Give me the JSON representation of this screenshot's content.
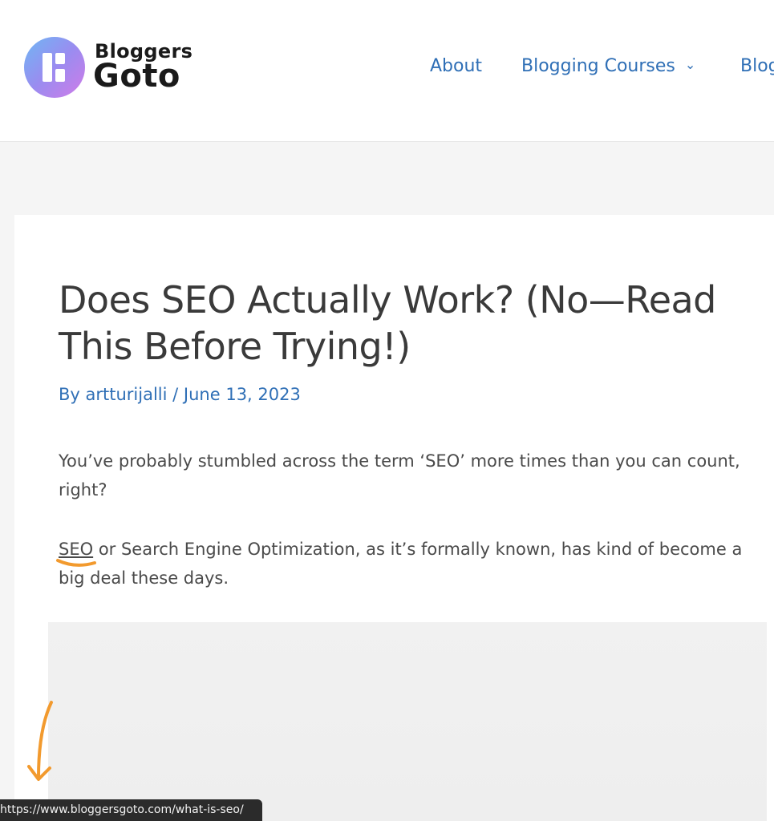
{
  "header": {
    "logo": {
      "line1": "Bloggers",
      "line2": "Goto"
    },
    "nav": [
      {
        "label": "About"
      },
      {
        "label": "Blogging Courses",
        "dropdown": true
      },
      {
        "label": "Blog"
      }
    ]
  },
  "article": {
    "title": "Does SEO Actually Work? (No—Read This Before Trying!)",
    "meta": {
      "prefix": "By ",
      "author": "artturijalli",
      "separator": " / ",
      "date": "June 13, 2023"
    },
    "paragraphs": {
      "p1": "You’ve probably stumbled across the term ‘SEO’ more times than you can count, right?",
      "p2_link": "SEO",
      "p2_rest": " or Search Engine Optimization, as it’s formally known, has kind of become a big deal these days."
    }
  },
  "status_bar": {
    "url": "https://www.bloggersgoto.com/what-is-seo/"
  },
  "annotations": {
    "color": "#f29a2e"
  },
  "colors": {
    "link": "#2f6fb6",
    "text": "#4a4a4a",
    "heading": "#3a3a3a"
  }
}
